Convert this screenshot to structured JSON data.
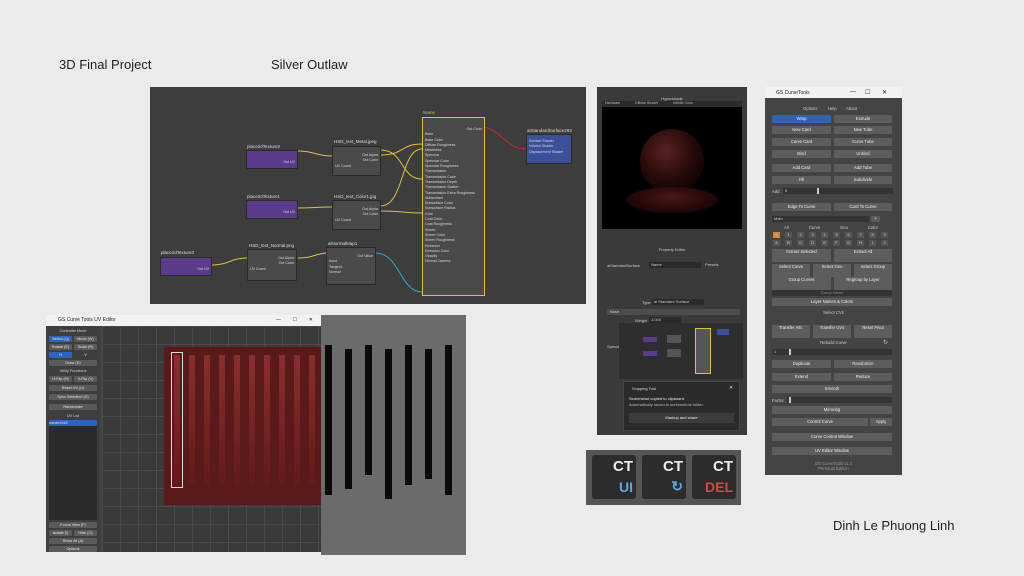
{
  "slide": {
    "project_title": "3D Final Project",
    "subtitle": "Silver Outlaw",
    "author": "Dinh Le Phuong Linh"
  },
  "node_editor": {
    "nodes": {
      "place2d_2": "place2dTexture2",
      "place2d_1": "place2dTexture1",
      "place2d_3": "place2dTexture3",
      "file_metal": "HSD_text_Metal.jpeg",
      "file_color": "HSD_text_Color1.jpg",
      "file_normal": "HSD_text_Normal.png",
      "bump": "aiNormalMap1",
      "standard": "aiStandardSurface293",
      "big_node_title": "Name"
    },
    "ports": {
      "out_uv": "Out UV",
      "out_alpha": "Out Alpha",
      "out_color": "Out Color",
      "uv_coord": "UV Coord",
      "out_value": "Out Value",
      "input": "Input",
      "tangent": "Tangent",
      "normal": "Normal"
    },
    "standard_attrs": [
      "Base",
      "Base Color",
      "Diffuse Roughness",
      "Metalness",
      "Specular",
      "Specular Color",
      "Specular Roughness",
      "Transmission",
      "Transmission Color",
      "Transmission Depth",
      "Transmission Scatter",
      "Transmission Extra Roughness",
      "Subsurface",
      "Subsurface Color",
      "Subsurface Radius",
      "Coat",
      "Coat Color",
      "Coat Roughness",
      "Sheen",
      "Sheen Color",
      "Sheen Roughness",
      "Emission",
      "Emission Color",
      "Opacity",
      "Normal Camera"
    ],
    "sg_rows": [
      "Surface Shader",
      "Volume Shader",
      "Displacement Shader"
    ]
  },
  "uv_editor": {
    "window_title": "GS Curve Tools UV Editor",
    "controller_mode": "Controller Mode",
    "select": "Select (Q)",
    "move": "Move (W)",
    "rotate": "Rotate (E)",
    "scale": "Scale (R)",
    "h": "H",
    "v": "V",
    "draw": "Draw (D)",
    "utility": "Utility Functions",
    "hflip": "H-Flip (H)",
    "vflip": "V-Flip (V)",
    "reset_uv": "Reset UV (U)",
    "sync": "Sync Selection (S)",
    "randomize": "Randomize",
    "uv_list": "UV List",
    "uv_item": "curveUV#2",
    "focus": "Focus View (F)",
    "isolate": "Isolate (I)",
    "hide": "Hide (O)",
    "show_all": "Show All (A)",
    "options": "Options"
  },
  "hypershade": {
    "top_title": "Hypershade",
    "renderer": "Hardware",
    "mode": "Diffuse Shader",
    "env": "Infinite Color",
    "prop_title": "Property Editor",
    "name_label": "aiStandardSurface",
    "name_value": "Name",
    "presets": "Presets",
    "type": "Type",
    "type_value": "ai Standard Surface",
    "base": "Base",
    "weight": "Weight",
    "weight_value": "1.000",
    "spec": "Specular",
    "toast_app": "Snipping Tool",
    "toast_line1": "Screenshot copied to clipboard",
    "toast_line2": "Automatically saved to screenshots folder.",
    "toast_action": "Markup and share"
  },
  "curve_tools": {
    "window_title": "GS CurveTools",
    "menu": [
      "Options",
      "Help",
      "About"
    ],
    "warp": "Warp",
    "extrude": "Extrude",
    "new_card": "New Card",
    "new_tube": "New Tube",
    "curve_card": "Curve Card",
    "curve_tube": "Curve Tube",
    "bind": "Bind",
    "unbind": "Unbind",
    "add_card": "Add Card",
    "add_tube": "Add Tube",
    "fill": "Fill",
    "subdivide": "Subdivide",
    "add": "Add",
    "add_value": "5",
    "edge_to_curve": "Edge To Curve",
    "card_to_curve": "Card To Curve",
    "main": "Main",
    "plus": "+",
    "layer_tabs": [
      "All",
      "Curve",
      "Geo",
      "Color"
    ],
    "layers_row1": [
      "0",
      "1",
      "2",
      "3",
      "4",
      "5",
      "6",
      "7",
      "8",
      "9"
    ],
    "layers_row2": [
      "A",
      "B",
      "C",
      "D",
      "E",
      "F",
      "G",
      "H",
      "I",
      "J"
    ],
    "extract_selected": "Extract Selected",
    "extract_all": "Extract All",
    "select_curve": "Select Curve",
    "select_geo": "Select Geo",
    "select_group": "Select Group",
    "group_curves": "Group Curves",
    "regroup": "Regroup by Layer",
    "group_name": "Group Name",
    "layer_names": "Layer Names & Colors",
    "select_cvs": "Select CVs",
    "transfer_attr": "Transfer Attr.",
    "transfer_uvs": "Transfer UVs",
    "reset_pivot": "Reset Pivot",
    "rebuild": "Rebuild Curve",
    "rebuild_value": "1",
    "duplicate": "Duplicate",
    "randomize": "Randomize",
    "extend": "Extend",
    "reduce": "Reduce",
    "smooth": "Smooth",
    "factor": "Factor",
    "mirroring": "Mirroring",
    "control_curve": "Control Curve",
    "apply": "Apply",
    "cc_window": "Curve Control Window",
    "uv_window": "UV Editor Window",
    "version": "GS CurveTools v1.3",
    "edition": "Personal Edition"
  },
  "logos": [
    {
      "ct": "CT",
      "sub": "UI",
      "color": "#d04a4a"
    },
    {
      "ct": "CT",
      "sub": "↻",
      "color": "#d04a4a"
    },
    {
      "ct": "CT",
      "sub": "DEL",
      "color": "#d04a4a"
    }
  ],
  "colors": {
    "accent_blue": "#2f63b8",
    "node_purple": "#5b3b8c",
    "wire_yellow": "#e0c040",
    "uv_red": "#7a2020"
  }
}
